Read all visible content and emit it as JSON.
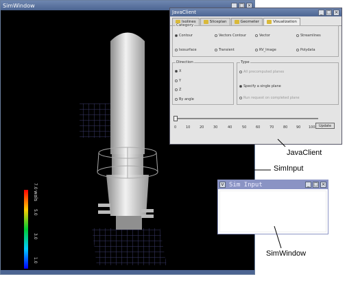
{
  "simwindow": {
    "title": "SimWindow"
  },
  "legend": {
    "label": "wals",
    "ticks": [
      "7.0",
      "5.0",
      "3.0",
      "1.0"
    ]
  },
  "javaclient": {
    "title": "JavaClient",
    "tabs": [
      "Isolines",
      "Sliceplan",
      "Geometer",
      "Visualization"
    ],
    "category_label": "Category",
    "category_options": [
      "Contour",
      "Vectors Contour",
      "Vector",
      "Streamlines",
      "Isosurface",
      "Transient",
      "RV_Image",
      "Polydata"
    ],
    "direction_label": "Direction",
    "direction_options": [
      "X",
      "Y",
      "Z",
      "By angle"
    ],
    "type_label": "Type",
    "type_options": [
      "All precomputed planes",
      "Specify a single plane",
      "Run request on completed plane"
    ],
    "slider_ticks": [
      "0",
      "10",
      "20",
      "30",
      "40",
      "50",
      "60",
      "70",
      "80",
      "90",
      "100"
    ],
    "update_label": "Update"
  },
  "siminput": {
    "title": "Sim Input"
  },
  "labels": {
    "javaclient": "JavaClient",
    "siminput": "SimInput",
    "simwindow": "SimWindow"
  }
}
